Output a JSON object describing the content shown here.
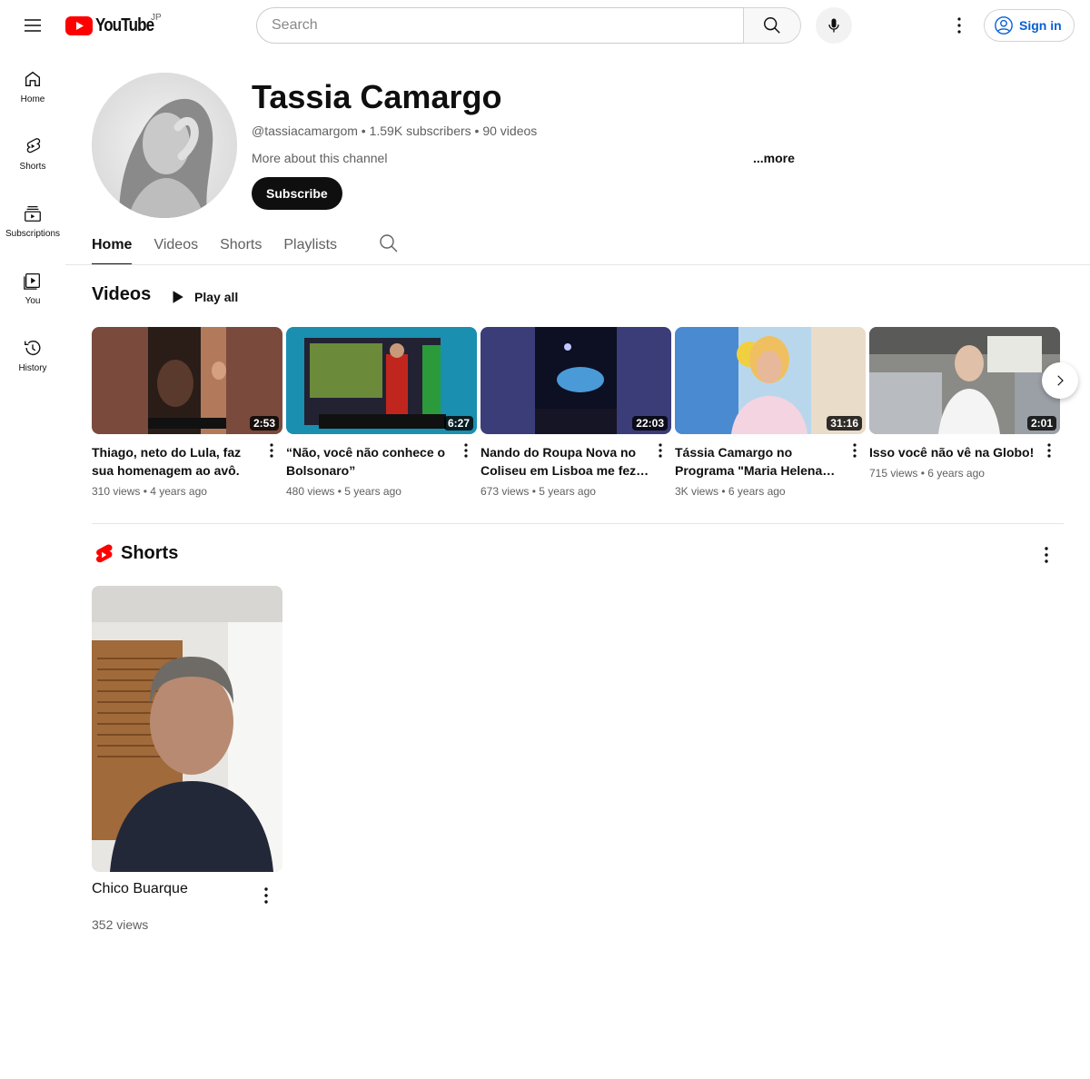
{
  "header": {
    "logo_text": "YouTube",
    "region": "JP",
    "search_placeholder": "Search",
    "sign_in": "Sign in",
    "brand_color": "#ff0000"
  },
  "guide": {
    "items": [
      {
        "label": "Home",
        "icon": "home-icon"
      },
      {
        "label": "Shorts",
        "icon": "shorts-icon"
      },
      {
        "label": "Subscriptions",
        "icon": "subscriptions-icon"
      },
      {
        "label": "You",
        "icon": "you-icon"
      },
      {
        "label": "History",
        "icon": "history-icon"
      }
    ]
  },
  "channel": {
    "name": "Tassia Camargo",
    "meta": "@tassiacamargom • 1.59K subscribers • 90 videos",
    "about": "More about this channel",
    "more": "...more",
    "subscribe": "Subscribe"
  },
  "tabs": [
    "Home",
    "Videos",
    "Shorts",
    "Playlists"
  ],
  "videos_shelf": {
    "title": "Videos",
    "play_all": "Play all",
    "items": [
      {
        "title": "Thiago, neto do Lula, faz sua homenagem ao avô.",
        "duration": "2:53",
        "meta": "310 views • 4 years ago"
      },
      {
        "title": "“Não, você não conhece o Bolsonaro”",
        "duration": "6:27",
        "meta": "480 views • 5 years ago"
      },
      {
        "title": "Nando do Roupa Nova no Coliseu em Lisboa me fez…",
        "duration": "22:03",
        "meta": "673 views • 5 years ago"
      },
      {
        "title": "Tássia Camargo no Programa \"Maria Helena…",
        "duration": "31:16",
        "meta": "3K views • 6 years ago"
      },
      {
        "title": "Isso você não vê na Globo!",
        "duration": "2:01",
        "meta": "715 views • 6 years ago"
      }
    ]
  },
  "shorts_shelf": {
    "title": "Shorts",
    "items": [
      {
        "title": "Chico Buarque",
        "views": "352 views"
      }
    ]
  }
}
